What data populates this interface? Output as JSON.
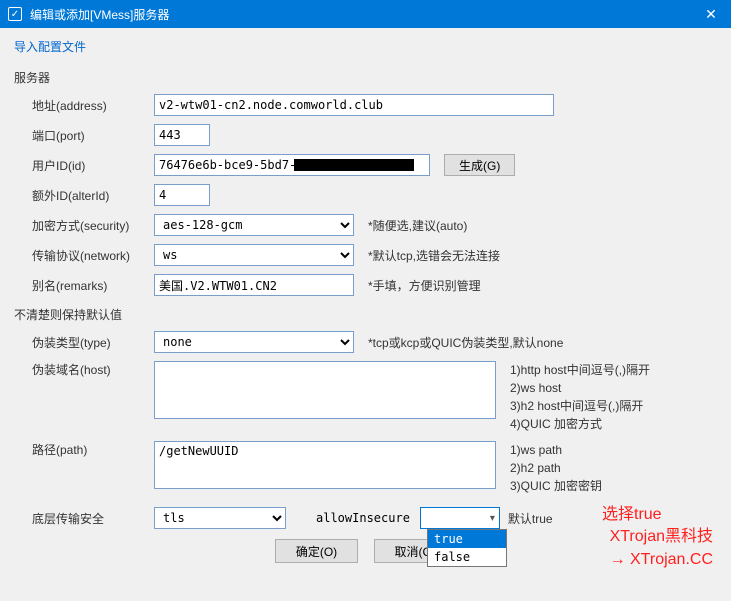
{
  "window": {
    "title": "编辑或添加[VMess]服务器",
    "close": "✕",
    "icon_check": "✓"
  },
  "import_link": "导入配置文件",
  "group_server": "服务器",
  "group_default": "不清楚则保持默认值",
  "labels": {
    "address": "地址(address)",
    "port": "端口(port)",
    "id": "用户ID(id)",
    "alterId": "额外ID(alterId)",
    "security": "加密方式(security)",
    "network": "传输协议(network)",
    "remarks": "别名(remarks)",
    "type": "伪装类型(type)",
    "host": "伪装域名(host)",
    "path": "路径(path)",
    "tls": "底层传输安全",
    "allowInsecure": "allowInsecure"
  },
  "values": {
    "address": "v2-wtw01-cn2.node.comworld.club",
    "port": "443",
    "id": "76476e6b-bce9-5bd7-",
    "alterId": "4",
    "security": "aes-128-gcm",
    "network": "ws",
    "remarks": "美国.V2.WTW01.CN2",
    "type": "none",
    "host": "",
    "path": "/getNewUUID",
    "tls": "tls",
    "allowInsecure": ""
  },
  "hints": {
    "security": "*随便选,建议(auto)",
    "network": "*默认tcp,选错会无法连接",
    "remarks": "*手填，方便识别管理",
    "type": "*tcp或kcp或QUIC伪装类型,默认none",
    "host1": "1)http host中间逗号(,)隔开",
    "host2": "2)ws host",
    "host3": "3)h2 host中间逗号(,)隔开",
    "host4": "4)QUIC 加密方式",
    "path1": "1)ws path",
    "path2": "2)h2 path",
    "path3": "3)QUIC 加密密钥",
    "allowInsecure": "默认true"
  },
  "buttons": {
    "generate": "生成(G)",
    "ok": "确定(O)",
    "cancel": "取消(C)"
  },
  "dropdown": {
    "true": "true",
    "false": "false"
  },
  "annotation": "选择true",
  "watermark": {
    "line1": "XTrojan黑科技",
    "line2": "→ XTrojan.CC"
  }
}
